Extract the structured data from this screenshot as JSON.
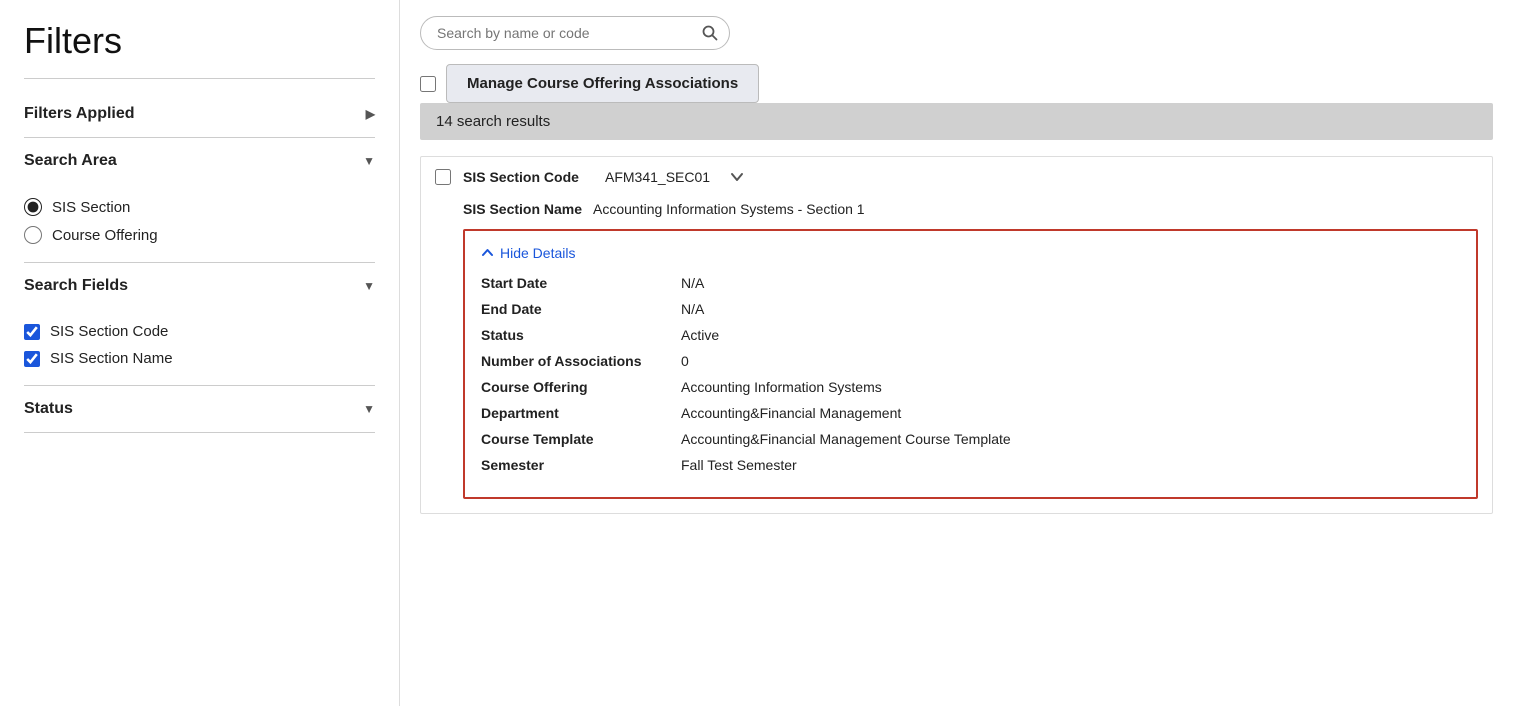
{
  "sidebar": {
    "title": "Filters",
    "filters_applied": {
      "label": "Filters Applied",
      "chevron": "▶"
    },
    "search_area": {
      "label": "Search Area",
      "chevron": "▼",
      "options": [
        {
          "id": "sis-section",
          "label": "SIS Section",
          "checked": true
        },
        {
          "id": "course-offering",
          "label": "Course Offering",
          "checked": false
        }
      ]
    },
    "search_fields": {
      "label": "Search Fields",
      "chevron": "▼",
      "options": [
        {
          "id": "sis-section-code",
          "label": "SIS Section Code",
          "checked": true
        },
        {
          "id": "sis-section-name",
          "label": "SIS Section Name",
          "checked": true
        }
      ]
    },
    "status": {
      "label": "Status",
      "chevron": "▼"
    }
  },
  "main": {
    "search_placeholder": "Search by name or code",
    "search_icon": "🔍",
    "manage_button_label": "Manage Course Offering Associations",
    "results_bar_text": "14 search results",
    "result": {
      "sis_section_code_label": "SIS Section Code",
      "sis_section_code_value": "AFM341_SEC01",
      "sis_section_name_label": "SIS Section Name",
      "sis_section_name_value": "Accounting Information Systems - Section 1",
      "hide_details_label": "Hide Details",
      "details": [
        {
          "label": "Start Date",
          "value": "N/A"
        },
        {
          "label": "End Date",
          "value": "N/A"
        },
        {
          "label": "Status",
          "value": "Active"
        },
        {
          "label": "Number of Associations",
          "value": "0"
        },
        {
          "label": "Course Offering",
          "value": "Accounting Information Systems"
        },
        {
          "label": "Department",
          "value": "Accounting&Financial Management"
        },
        {
          "label": "Course Template",
          "value": "Accounting&Financial Management Course Template"
        },
        {
          "label": "Semester",
          "value": "Fall Test Semester"
        }
      ]
    }
  }
}
